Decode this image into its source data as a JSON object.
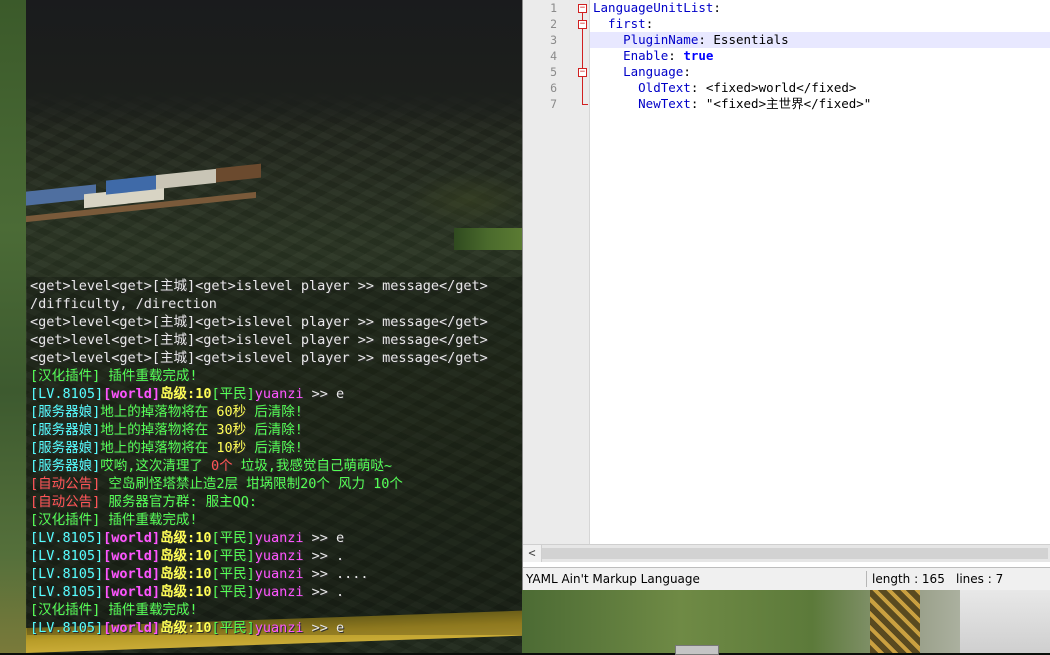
{
  "game_chat": {
    "lines": [
      [
        {
          "t": "<get>level<get>[主城]<get>islevel player >> message</get>",
          "c": "#e8e8e8"
        }
      ],
      [
        {
          "t": "/difficulty, /direction",
          "c": "#e8e8e8"
        }
      ],
      [
        {
          "t": "<get>level<get>[主城]<get>islevel player >> message</get>",
          "c": "#e8e8e8"
        }
      ],
      [
        {
          "t": "<get>level<get>[主城]<get>islevel player >> message</get>",
          "c": "#e8e8e8"
        }
      ],
      [
        {
          "t": "<get>level<get>[主城]<get>islevel player >> message</get>",
          "c": "#e8e8e8"
        }
      ],
      [
        {
          "t": "[汉化插件] 插件重载完成!",
          "c": "#55ff55"
        }
      ],
      [
        {
          "t": "[LV.8105]",
          "c": "#55ffff"
        },
        {
          "t": "[world]",
          "c": "#ff55ff",
          "b": true
        },
        {
          "t": "岛级:10",
          "c": "#ffff55",
          "b": true
        },
        {
          "t": "[平民]",
          "c": "#55ff55"
        },
        {
          "t": "yuanzi",
          "c": "#ff55ff"
        },
        {
          "t": " >> e",
          "c": "#e8e8e8"
        }
      ],
      [
        {
          "t": "[服务器娘]",
          "c": "#55ffff"
        },
        {
          "t": "地上的掉落物将在 ",
          "c": "#55ff55"
        },
        {
          "t": "60秒",
          "c": "#ffff55"
        },
        {
          "t": " 后清除!",
          "c": "#55ff55"
        }
      ],
      [
        {
          "t": "[服务器娘]",
          "c": "#55ffff"
        },
        {
          "t": "地上的掉落物将在 ",
          "c": "#55ff55"
        },
        {
          "t": "30秒",
          "c": "#ffff55"
        },
        {
          "t": " 后清除!",
          "c": "#55ff55"
        }
      ],
      [
        {
          "t": "[服务器娘]",
          "c": "#55ffff"
        },
        {
          "t": "地上的掉落物将在 ",
          "c": "#55ff55"
        },
        {
          "t": "10秒",
          "c": "#ffff55"
        },
        {
          "t": " 后清除!",
          "c": "#55ff55"
        }
      ],
      [
        {
          "t": "[服务器娘]",
          "c": "#55ffff"
        },
        {
          "t": "哎哟,这次清理了 ",
          "c": "#55ff55"
        },
        {
          "t": "0个",
          "c": "#ff5555"
        },
        {
          "t": " 垃圾,我感觉自己萌萌哒~",
          "c": "#55ff55"
        }
      ],
      [
        {
          "t": "[自动公告]",
          "c": "#ff5555"
        },
        {
          "t": " 空岛刷怪塔禁止造2层 坩埚限制20个 风力 10个",
          "c": "#55ff55"
        }
      ],
      [
        {
          "t": "[自动公告]",
          "c": "#ff5555"
        },
        {
          "t": " 服务器官方群: 服主QQ:",
          "c": "#55ff55"
        }
      ],
      [
        {
          "t": "[汉化插件] 插件重载完成!",
          "c": "#55ff55"
        }
      ],
      [
        {
          "t": "[LV.8105]",
          "c": "#55ffff"
        },
        {
          "t": "[world]",
          "c": "#ff55ff",
          "b": true
        },
        {
          "t": "岛级:10",
          "c": "#ffff55",
          "b": true
        },
        {
          "t": "[平民]",
          "c": "#55ff55"
        },
        {
          "t": "yuanzi",
          "c": "#ff55ff"
        },
        {
          "t": " >> e",
          "c": "#e8e8e8"
        }
      ],
      [
        {
          "t": "[LV.8105]",
          "c": "#55ffff"
        },
        {
          "t": "[world]",
          "c": "#ff55ff",
          "b": true
        },
        {
          "t": "岛级:10",
          "c": "#ffff55",
          "b": true
        },
        {
          "t": "[平民]",
          "c": "#55ff55"
        },
        {
          "t": "yuanzi",
          "c": "#ff55ff"
        },
        {
          "t": " >> .",
          "c": "#e8e8e8"
        }
      ],
      [
        {
          "t": "[LV.8105]",
          "c": "#55ffff"
        },
        {
          "t": "[world]",
          "c": "#ff55ff",
          "b": true
        },
        {
          "t": "岛级:10",
          "c": "#ffff55",
          "b": true
        },
        {
          "t": "[平民]",
          "c": "#55ff55"
        },
        {
          "t": "yuanzi",
          "c": "#ff55ff"
        },
        {
          "t": " >> ....",
          "c": "#e8e8e8"
        }
      ],
      [
        {
          "t": "[LV.8105]",
          "c": "#55ffff"
        },
        {
          "t": "[world]",
          "c": "#ff55ff",
          "b": true
        },
        {
          "t": "岛级:10",
          "c": "#ffff55",
          "b": true
        },
        {
          "t": "[平民]",
          "c": "#55ff55"
        },
        {
          "t": "yuanzi",
          "c": "#ff55ff"
        },
        {
          "t": " >> .",
          "c": "#e8e8e8"
        }
      ],
      [
        {
          "t": "[汉化插件] 插件重载完成!",
          "c": "#55ff55"
        }
      ],
      [
        {
          "t": "[LV.8105]",
          "c": "#55ffff"
        },
        {
          "t": "[world]",
          "c": "#ff55ff",
          "b": true
        },
        {
          "t": "岛级:10",
          "c": "#ffff55",
          "b": true
        },
        {
          "t": "[平民]",
          "c": "#55ff55"
        },
        {
          "t": "yuanzi",
          "c": "#ff55ff"
        },
        {
          "t": " >> e",
          "c": "#e8e8e8"
        }
      ]
    ]
  },
  "editor": {
    "line_numbers": [
      "1",
      "2",
      "3",
      "4",
      "5",
      "6",
      "7"
    ],
    "code": [
      [
        {
          "t": "LanguageUnitList",
          "k": "key"
        },
        {
          "t": ":",
          "k": "val"
        }
      ],
      [
        {
          "t": "  first",
          "k": "key"
        },
        {
          "t": ":",
          "k": "val"
        }
      ],
      [
        {
          "t": "    PluginName",
          "k": "key"
        },
        {
          "t": ": Essentials",
          "k": "val"
        }
      ],
      [
        {
          "t": "    Enable",
          "k": "key"
        },
        {
          "t": ": ",
          "k": "val"
        },
        {
          "t": "true",
          "k": "bool"
        }
      ],
      [
        {
          "t": "    Language",
          "k": "key"
        },
        {
          "t": ":",
          "k": "val"
        }
      ],
      [
        {
          "t": "      OldText",
          "k": "key"
        },
        {
          "t": ": <fixed>world</fixed>",
          "k": "val"
        }
      ],
      [
        {
          "t": "      NewText",
          "k": "key"
        },
        {
          "t": ": \"<fixed>主世界</fixed>\"",
          "k": "val"
        }
      ]
    ],
    "scroll_left_glyph": "<",
    "status": {
      "language": "YAML Ain't Markup Language",
      "length": "length : 165",
      "lines": "lines : 7"
    }
  },
  "colors": {
    "mc_green": "#55ff55",
    "mc_aqua": "#55ffff",
    "mc_pink": "#ff55ff",
    "mc_yellow": "#ffff55",
    "mc_red": "#ff5555",
    "yaml_key": "#0000c8",
    "yaml_bool": "#0000ff",
    "fold_marker": "#d12020"
  }
}
